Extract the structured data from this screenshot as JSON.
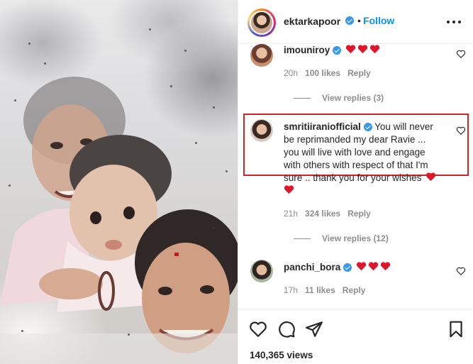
{
  "post": {
    "author": "ektarkapoor",
    "follow_label": "Follow",
    "separator": "•",
    "views": "140,365 views"
  },
  "comments": [
    {
      "username": "imouniroy",
      "text": "",
      "hearts": 3,
      "time": "20h",
      "likes": "100 likes",
      "reply_label": "Reply",
      "view_replies": "View replies (3)"
    },
    {
      "username": "smritiiraniofficial",
      "text_lines": [
        "You will never",
        "be reprimanded my dear Ravie ...",
        "you will live with love and engage",
        "with others with respect of that I'm",
        "sure .. thank you for your wishes"
      ],
      "hearts": 2,
      "time": "21h",
      "likes": "324 likes",
      "reply_label": "Reply",
      "view_replies": "View replies (12)",
      "highlighted": true
    },
    {
      "username": "panchi_bora",
      "text": "",
      "hearts": 3,
      "time": "17h",
      "likes": "11 likes",
      "reply_label": "Reply"
    }
  ],
  "colors": {
    "accent": "#0095f6",
    "verified": "#3897f0",
    "heart_emoji": "#e0152a",
    "highlight_border": "#d1232a",
    "muted": "#8e8e8e"
  },
  "icons": {
    "like": "heart-outline-icon",
    "comment": "speech-bubble-icon",
    "share": "paper-plane-icon",
    "save": "bookmark-icon",
    "more": "more-options-icon"
  }
}
